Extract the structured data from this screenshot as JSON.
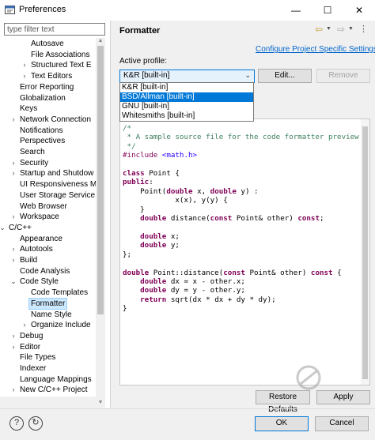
{
  "window": {
    "title": "Preferences"
  },
  "filter": {
    "placeholder": "type filter text"
  },
  "tree": [
    {
      "label": "Autosave",
      "indent": 3,
      "twisty": "none"
    },
    {
      "label": "File Associations",
      "indent": 3,
      "twisty": "none"
    },
    {
      "label": "Structured Text E",
      "indent": 3,
      "twisty": "closed"
    },
    {
      "label": "Text Editors",
      "indent": 3,
      "twisty": "closed"
    },
    {
      "label": "Error Reporting",
      "indent": 2,
      "twisty": "none"
    },
    {
      "label": "Globalization",
      "indent": 2,
      "twisty": "none"
    },
    {
      "label": "Keys",
      "indent": 2,
      "twisty": "none"
    },
    {
      "label": "Network Connection",
      "indent": 2,
      "twisty": "closed"
    },
    {
      "label": "Notifications",
      "indent": 2,
      "twisty": "none"
    },
    {
      "label": "Perspectives",
      "indent": 2,
      "twisty": "none"
    },
    {
      "label": "Search",
      "indent": 2,
      "twisty": "none"
    },
    {
      "label": "Security",
      "indent": 2,
      "twisty": "closed"
    },
    {
      "label": "Startup and Shutdow",
      "indent": 2,
      "twisty": "closed"
    },
    {
      "label": "UI Responsiveness M",
      "indent": 2,
      "twisty": "none"
    },
    {
      "label": "User Storage Service",
      "indent": 2,
      "twisty": "none"
    },
    {
      "label": "Web Browser",
      "indent": 2,
      "twisty": "none"
    },
    {
      "label": "Workspace",
      "indent": 2,
      "twisty": "closed"
    },
    {
      "label": "C/C++",
      "indent": 1,
      "twisty": "open"
    },
    {
      "label": "Appearance",
      "indent": 2,
      "twisty": "none"
    },
    {
      "label": "Autotools",
      "indent": 2,
      "twisty": "closed"
    },
    {
      "label": "Build",
      "indent": 2,
      "twisty": "closed"
    },
    {
      "label": "Code Analysis",
      "indent": 2,
      "twisty": "none"
    },
    {
      "label": "Code Style",
      "indent": 2,
      "twisty": "open"
    },
    {
      "label": "Code Templates",
      "indent": 3,
      "twisty": "none"
    },
    {
      "label": "Formatter",
      "indent": 3,
      "twisty": "none",
      "selected": true
    },
    {
      "label": "Name Style",
      "indent": 3,
      "twisty": "none"
    },
    {
      "label": "Organize Include",
      "indent": 3,
      "twisty": "closed"
    },
    {
      "label": "Debug",
      "indent": 2,
      "twisty": "closed"
    },
    {
      "label": "Editor",
      "indent": 2,
      "twisty": "closed"
    },
    {
      "label": "File Types",
      "indent": 2,
      "twisty": "none"
    },
    {
      "label": "Indexer",
      "indent": 2,
      "twisty": "none"
    },
    {
      "label": "Language Mappings",
      "indent": 2,
      "twisty": "none"
    },
    {
      "label": "New C/C++ Project",
      "indent": 2,
      "twisty": "closed"
    }
  ],
  "page": {
    "title": "Formatter",
    "configure_link": "Configure Project Specific Settings...",
    "active_profile_label": "Active profile:",
    "selected_profile": "K&R [built-in]",
    "profile_options": [
      "K&R [built-in]",
      "BSD/Allman [built-in]",
      "GNU [built-in]",
      "Whitesmiths [built-in]"
    ],
    "highlighted_option": 1,
    "edit_label": "Edit...",
    "remove_label": "Remove",
    "restore_label": "Restore Defaults",
    "apply_label": "Apply"
  },
  "preview_code": [
    [
      [
        "cm",
        "/*"
      ]
    ],
    [
      [
        "cm",
        " * A sample source file for the code formatter preview"
      ]
    ],
    [
      [
        "cm",
        " */"
      ]
    ],
    [
      [
        "mac",
        "#include "
      ],
      [
        "inc",
        "<math.h>"
      ]
    ],
    [],
    [
      [
        "kw",
        "class"
      ],
      [
        "tx",
        " Point {"
      ]
    ],
    [
      [
        "kw",
        "public"
      ],
      [
        "tx",
        ":"
      ]
    ],
    [
      [
        "tx",
        "    Point("
      ],
      [
        "kw",
        "double"
      ],
      [
        "tx",
        " x, "
      ],
      [
        "kw",
        "double"
      ],
      [
        "tx",
        " y) :"
      ]
    ],
    [
      [
        "tx",
        "            x(x), y(y) {"
      ]
    ],
    [
      [
        "tx",
        "    }"
      ]
    ],
    [
      [
        "tx",
        "    "
      ],
      [
        "kw",
        "double"
      ],
      [
        "tx",
        " distance("
      ],
      [
        "kw",
        "const"
      ],
      [
        "tx",
        " Point& other) "
      ],
      [
        "kw",
        "const"
      ],
      [
        "tx",
        ";"
      ]
    ],
    [],
    [
      [
        "tx",
        "    "
      ],
      [
        "kw",
        "double"
      ],
      [
        "tx",
        " x;"
      ]
    ],
    [
      [
        "tx",
        "    "
      ],
      [
        "kw",
        "double"
      ],
      [
        "tx",
        " y;"
      ]
    ],
    [
      [
        "tx",
        "};"
      ]
    ],
    [],
    [
      [
        "kw",
        "double"
      ],
      [
        "tx",
        " Point::distance("
      ],
      [
        "kw",
        "const"
      ],
      [
        "tx",
        " Point& other) "
      ],
      [
        "kw",
        "const"
      ],
      [
        "tx",
        " {"
      ]
    ],
    [
      [
        "tx",
        "    "
      ],
      [
        "kw",
        "double"
      ],
      [
        "tx",
        " dx = x - other.x;"
      ]
    ],
    [
      [
        "tx",
        "    "
      ],
      [
        "kw",
        "double"
      ],
      [
        "tx",
        " dy = y - other.y;"
      ]
    ],
    [
      [
        "tx",
        "    "
      ],
      [
        "kw",
        "return"
      ],
      [
        "tx",
        " sqrt(dx * dx + dy * dy);"
      ]
    ],
    [
      [
        "tx",
        "}"
      ]
    ]
  ],
  "footer": {
    "ok_label": "OK",
    "cancel_label": "Cancel"
  },
  "icons": {
    "help": "?",
    "import_export": "↻",
    "back": "⇦",
    "forward": "⇨",
    "menu": "⋮",
    "minimize": "—",
    "maximize": "☐",
    "close": "✕"
  },
  "colors": {
    "accent": "#0078d7",
    "link": "#0066cc",
    "comment": "#3f7f5f",
    "keyword": "#7f0055",
    "string": "#2a00ff"
  }
}
